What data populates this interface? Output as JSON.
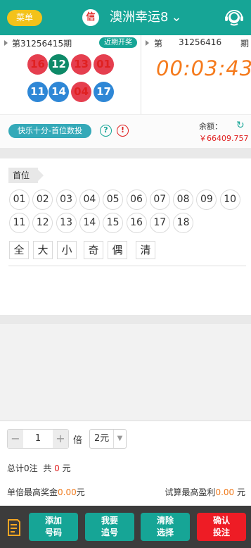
{
  "header": {
    "menu_label": "菜单",
    "badge_char": "信",
    "title": "澳洲幸运8",
    "chevron": "⌄",
    "support_icon": "customer-service-icon"
  },
  "draw": {
    "last_period": "第31256415期",
    "recent_label": "近期开奖",
    "balls": [
      {
        "num": "16",
        "color": "red"
      },
      {
        "num": "12",
        "color": "green"
      },
      {
        "num": "13",
        "color": "red"
      },
      {
        "num": "01",
        "color": "red"
      },
      {
        "num": "11",
        "color": "blue"
      },
      {
        "num": "14",
        "color": "blue"
      },
      {
        "num": "04",
        "color": "red"
      },
      {
        "num": "17",
        "color": "blue"
      }
    ],
    "next_prefix": "第",
    "next_number": "31256416",
    "next_suffix": "期",
    "countdown": "00:03:43"
  },
  "bet_type": {
    "label": "快乐十分-首位数投",
    "help": "?",
    "warn": "!",
    "balance_label": "余额：",
    "balance_value": "￥66409.757"
  },
  "selection": {
    "position_label": "首位",
    "numbers": [
      "01",
      "02",
      "03",
      "04",
      "05",
      "06",
      "07",
      "08",
      "09",
      "10",
      "11",
      "12",
      "13",
      "14",
      "15",
      "16",
      "17",
      "18"
    ],
    "quick": [
      "全",
      "大",
      "小",
      "奇",
      "偶",
      "清"
    ]
  },
  "controls": {
    "minus": "−",
    "plus": "+",
    "multiple": "1",
    "bei_label": "倍",
    "unit": "2元",
    "total_prefix": "总计",
    "total_count": "0",
    "total_unit": "注",
    "sum_prefix": "共",
    "sum_value": "0",
    "sum_unit": "元",
    "max_prize_prefix": "单倍最高奖金",
    "max_prize_value": "0.00",
    "max_prize_unit": "元",
    "max_profit_prefix": "试算最高盈利",
    "max_profit_value": "0.00",
    "max_profit_unit": "元"
  },
  "footer": {
    "doc_icon": "bet-list-icon",
    "buttons": [
      {
        "line1": "添加",
        "line2": "号码"
      },
      {
        "line1": "我要",
        "line2": "追号"
      },
      {
        "line1": "清除",
        "line2": "选择"
      },
      {
        "line1": "确认",
        "line2": "投注"
      }
    ]
  },
  "colors": {
    "primary": "#16a596",
    "menu_yellow": "#f3c21a",
    "ball_red": "#e53f4f",
    "ball_green": "#0e8a68",
    "ball_blue": "#2e87d6",
    "countdown_orange": "#f57a1c",
    "confirm_red": "#ee1c25"
  }
}
